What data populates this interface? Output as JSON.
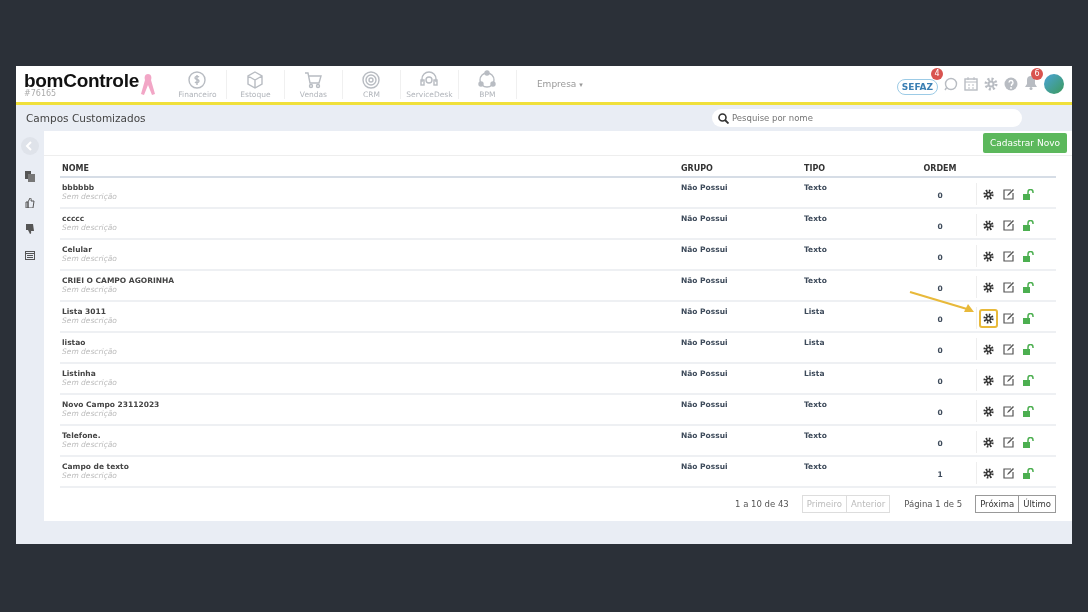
{
  "header": {
    "logo": "bomControle",
    "account": "#76165",
    "modules": [
      "Financeiro",
      "Estoque",
      "Vendas",
      "CRM",
      "ServiceDesk",
      "BPM"
    ],
    "company": "Empresa",
    "company_caret": "▾",
    "sefaz": {
      "label": "SEFAZ",
      "badge": "4"
    },
    "notifications_badge": "6"
  },
  "page": {
    "title": "Campos Customizados",
    "search": {
      "placeholder": "Pesquise por nome"
    },
    "new_button": "Cadastrar Novo"
  },
  "table": {
    "columns": [
      "NOME",
      "GRUPO",
      "TIPO",
      "ORDEM"
    ],
    "rows": [
      {
        "name": "bbbbbb",
        "description": "Sem descrição",
        "group": "Não Possui",
        "type": "Texto",
        "order": "0",
        "highlighted": false
      },
      {
        "name": "ccccc",
        "description": "Sem descrição",
        "group": "Não Possui",
        "type": "Texto",
        "order": "0",
        "highlighted": false
      },
      {
        "name": "Celular",
        "description": "Sem descrição",
        "group": "Não Possui",
        "type": "Texto",
        "order": "0",
        "highlighted": false
      },
      {
        "name": "CRIEI O CAMPO AGORINHA",
        "description": "Sem descrição",
        "group": "Não Possui",
        "type": "Texto",
        "order": "0",
        "highlighted": false
      },
      {
        "name": "Lista 3011",
        "description": "Sem descrição",
        "group": "Não Possui",
        "type": "Lista",
        "order": "0",
        "highlighted": true
      },
      {
        "name": "listao",
        "description": "Sem descrição",
        "group": "Não Possui",
        "type": "Lista",
        "order": "0",
        "highlighted": false
      },
      {
        "name": "Listinha",
        "description": "Sem descrição",
        "group": "Não Possui",
        "type": "Lista",
        "order": "0",
        "highlighted": false
      },
      {
        "name": "Novo Campo 23112023",
        "description": "Sem descrição",
        "group": "Não Possui",
        "type": "Texto",
        "order": "0",
        "highlighted": false
      },
      {
        "name": "Telefone.",
        "description": "Sem descrição",
        "group": "Não Possui",
        "type": "Texto",
        "order": "0",
        "highlighted": false
      },
      {
        "name": "Campo de texto",
        "description": "Sem descrição",
        "group": "Não Possui",
        "type": "Texto",
        "order": "1",
        "highlighted": false
      }
    ]
  },
  "pagination": {
    "summary": "1 a 10 de 43",
    "page": "Página 1 de 5",
    "buttons": [
      {
        "label": "Primeiro",
        "disabled": true
      },
      {
        "label": "Anterior",
        "disabled": true
      },
      {
        "label": "Próxima",
        "disabled": false
      },
      {
        "label": "Último",
        "disabled": false
      }
    ]
  }
}
